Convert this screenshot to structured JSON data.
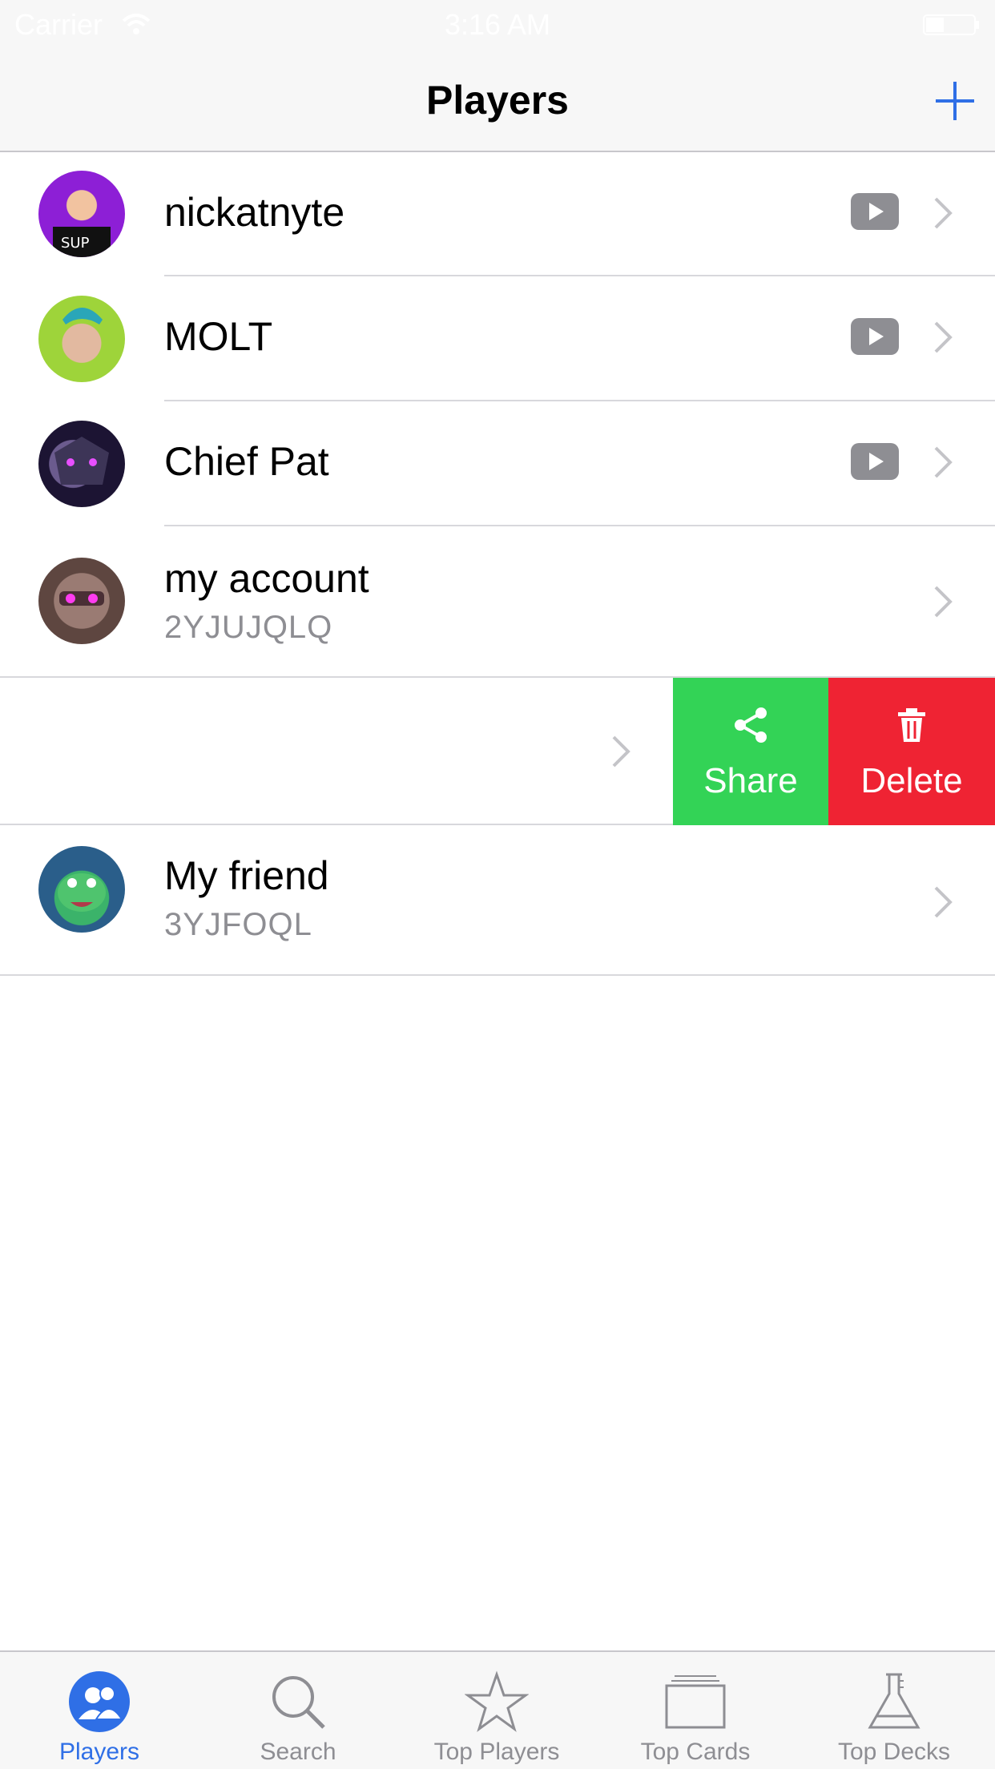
{
  "status_bar": {
    "carrier": "Carrier",
    "time": "3:16 AM"
  },
  "nav": {
    "title": "Players"
  },
  "players": [
    {
      "name": "nickatnyte",
      "has_youtube": true
    },
    {
      "name": "MOLT",
      "has_youtube": true
    },
    {
      "name": "Chief Pat",
      "has_youtube": true
    },
    {
      "name": "my account",
      "tag": "2YJUJQLQ"
    },
    {
      "name": "My friend",
      "tag": "3YJFOQL"
    }
  ],
  "swipe_actions": {
    "share": "Share",
    "delete": "Delete"
  },
  "tabbar": {
    "tabs": [
      {
        "label": "Players",
        "active": true
      },
      {
        "label": "Search"
      },
      {
        "label": "Top Players"
      },
      {
        "label": "Top Cards"
      },
      {
        "label": "Top Decks"
      }
    ]
  },
  "colors": {
    "accent": "#2f6fe6",
    "share": "#33d356",
    "delete": "#ef2333"
  }
}
